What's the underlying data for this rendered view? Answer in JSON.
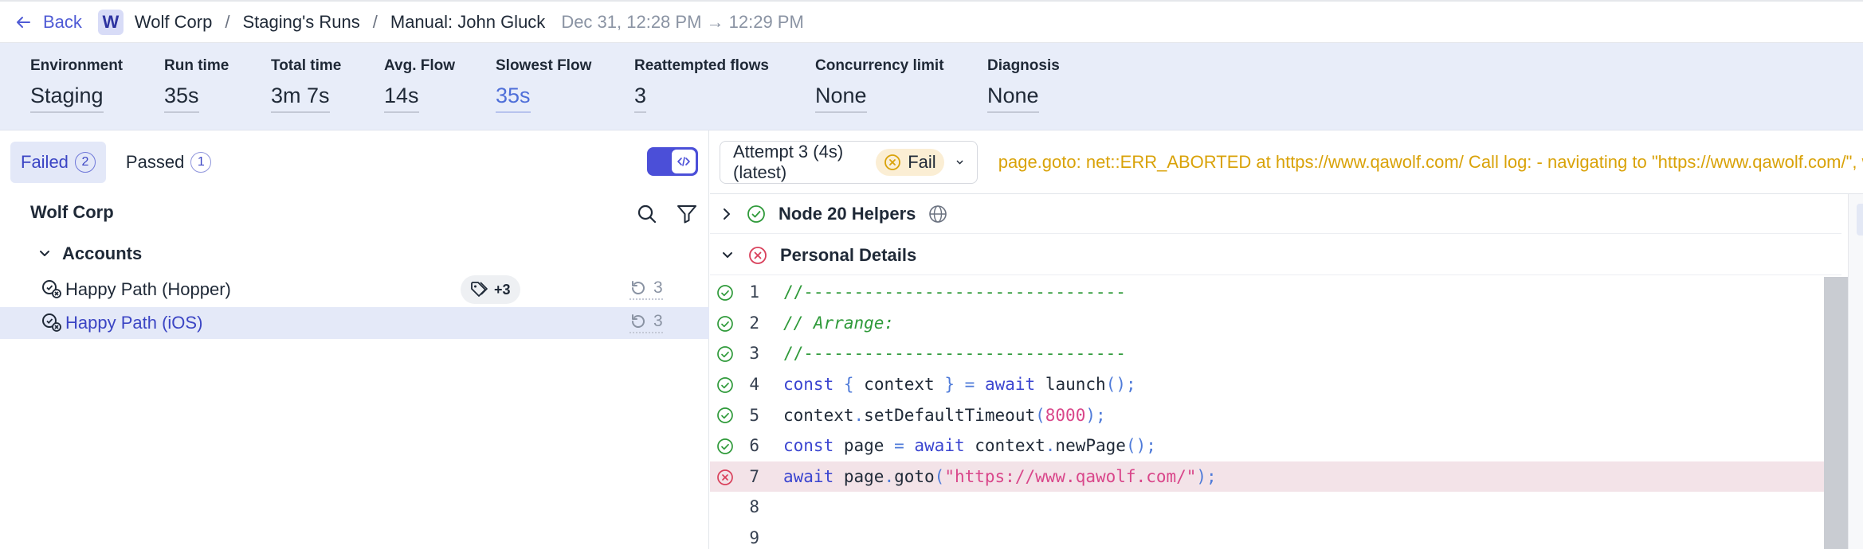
{
  "header": {
    "back_label": "Back",
    "workspace_initial": "W",
    "breadcrumb": [
      "Wolf Corp",
      "Staging's Runs",
      "Manual: John Gluck"
    ],
    "date_range": "Dec 31, 12:28 PM → 12:29 PM"
  },
  "summary": {
    "metrics": [
      {
        "label": "Environment",
        "value": "Staging"
      },
      {
        "label": "Run time",
        "value": "35s"
      },
      {
        "label": "Total time",
        "value": "3m 7s"
      },
      {
        "label": "Avg. Flow",
        "value": "14s"
      },
      {
        "label": "Slowest Flow",
        "value": "35s"
      },
      {
        "label": "Reattempted flows",
        "value": "3"
      },
      {
        "label": "Concurrency limit",
        "value": "None"
      },
      {
        "label": "Diagnosis",
        "value": "None"
      }
    ]
  },
  "sidebar": {
    "tabs": [
      {
        "label": "Failed",
        "count": "2"
      },
      {
        "label": "Passed",
        "count": "1"
      }
    ],
    "tree_root": "Wolf Corp",
    "group": "Accounts",
    "flows": [
      {
        "name": "Happy Path (Hopper)",
        "tag_extra": "+3",
        "retries": "3"
      },
      {
        "name": "Happy Path (iOS)",
        "retries": "3"
      }
    ]
  },
  "detail": {
    "attempt_label": "Attempt 3 (4s) (latest)",
    "status_label": "Fail",
    "error_message": "page.goto: net::ERR_ABORTED at https://www.qawolf.com/ Call log: - navigating to \"https://www.qawolf.com/\", waiting until \"load\"",
    "sections": [
      {
        "title": "Node 20 Helpers"
      },
      {
        "title": "Personal Details"
      }
    ],
    "code_lines": [
      "1",
      "2",
      "3",
      "4",
      "5",
      "6",
      "7",
      "8",
      "9"
    ]
  },
  "colors": {
    "accent": "#4b4fd8",
    "pass": "#2f9a3a",
    "fail": "#d9405b",
    "warning": "#d9a208"
  }
}
